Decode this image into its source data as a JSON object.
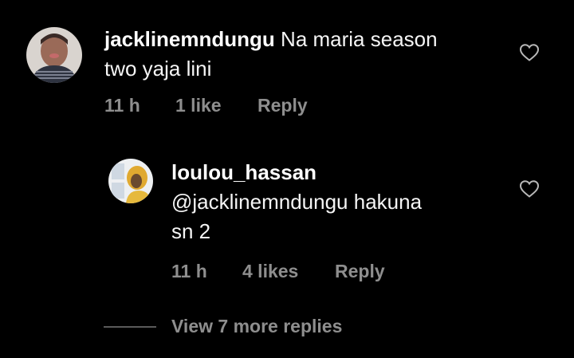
{
  "comment": {
    "username": "jacklinemndungu",
    "text_line1": "Na maria season",
    "text_line2": "two yaja lini",
    "time": "11 h",
    "likes": "1 like",
    "reply_label": "Reply"
  },
  "reply": {
    "username": "loulou_hassan",
    "text_line1": "@jacklinemndungu hakuna",
    "text_line2": "sn 2",
    "time": "11 h",
    "likes": "4 likes",
    "reply_label": "Reply"
  },
  "view_more": {
    "label": "View 7 more replies"
  },
  "colors": {
    "background": "#000000",
    "text": "#f5f5f5",
    "meta": "#8e8e8e"
  },
  "icons": {
    "like": "heart-outline-icon"
  }
}
